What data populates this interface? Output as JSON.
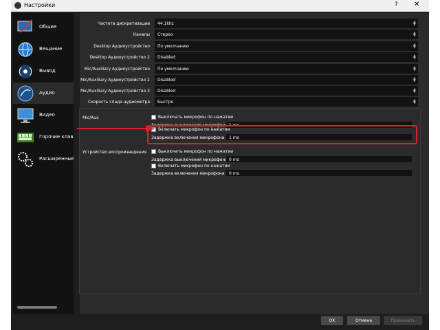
{
  "window": {
    "title": "Настройки",
    "help": "?",
    "close": "✕"
  },
  "sidebar": {
    "items": [
      {
        "label": "Общие",
        "icon": "monitor-pen-icon"
      },
      {
        "label": "Вещание",
        "icon": "globe-icon"
      },
      {
        "label": "Вывод",
        "icon": "antenna-icon"
      },
      {
        "label": "Аудио",
        "icon": "speaker-icon"
      },
      {
        "label": "Видео",
        "icon": "display-icon"
      },
      {
        "label": "Горячие клавиши",
        "icon": "keyboard-icon"
      },
      {
        "label": "Расширенные",
        "icon": "gears-icon"
      }
    ]
  },
  "general": [
    {
      "label": "Частота дискретизации",
      "value": "44.1khz"
    },
    {
      "label": "Каналы",
      "value": "Стерео"
    },
    {
      "label": "Desktop Аудиоустройство",
      "value": "По умолчанию"
    },
    {
      "label": "Desktop Аудиоустройство 2",
      "value": "Disabled"
    },
    {
      "label": "Mic/Auxiliary Аудиоустройство",
      "value": "По умолчанию"
    },
    {
      "label": "Mic/Auxiliary Аудиоустройство 2",
      "value": "Disabled"
    },
    {
      "label": "Mic/Auxiliary Аудиоустройство 3",
      "value": "Disabled"
    },
    {
      "label": "Скорость спада аудиометра",
      "value": "Быстро"
    }
  ],
  "hotkeys": {
    "mic_group": "Mic/Aux",
    "mute_ptt": "Выключать микрофон по нажатии",
    "mute_delay_label": "Задержка выключения микрофона",
    "mute_delay": "1 ms",
    "enable_ptt": "Включать микрофон по нажатии",
    "enable_delay_label": "Задержка включения микрофона",
    "enable_delay": "1 ms",
    "playback_group": "Устройство воспроизведения",
    "pb_mute_ptt": "Выключать микрофон по нажатии",
    "pb_mute_delay_label": "Задержка выключения микрофона",
    "pb_mute_delay": "0 ms",
    "pb_enable_ptt": "Включать микрофон по нажатии",
    "pb_enable_delay_label": "Задержка включения микрофона",
    "pb_enable_delay": "0 ms",
    "checked_mark": "✓"
  },
  "buttons": {
    "ok": "OK",
    "cancel": "Отмена",
    "apply": "Применить"
  },
  "colors": {
    "highlight": "#d9232b"
  }
}
